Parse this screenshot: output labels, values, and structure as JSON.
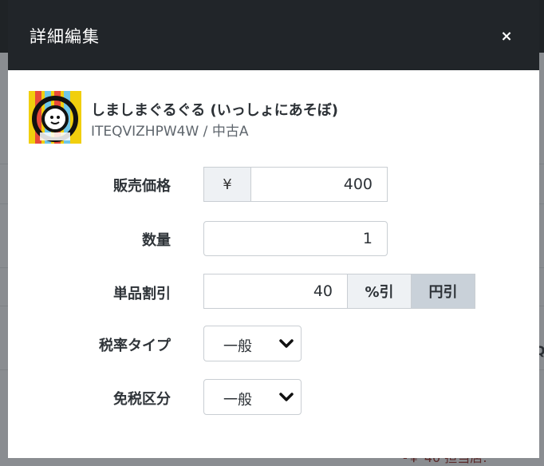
{
  "modal": {
    "title": "詳細編集",
    "close_symbol": "×"
  },
  "product": {
    "name": "しましまぐるぐる (いっしょにあそぼ)",
    "code_condition": "ITEQVIZHPW4W / 中古A"
  },
  "form": {
    "price": {
      "label": "販売価格",
      "currency_symbol": "¥",
      "value": "400"
    },
    "quantity": {
      "label": "数量",
      "value": "1"
    },
    "discount": {
      "label": "単品割引",
      "value": "40",
      "options": [
        "%引",
        "円引"
      ],
      "selected": "円引"
    },
    "tax_rate_type": {
      "label": "税率タイプ",
      "value": "一般"
    },
    "tax_exemption": {
      "label": "免税区分",
      "value": "一般"
    }
  },
  "background": {
    "partial_text": "-￥ 40   担当店:"
  },
  "colors": {
    "header_bg": "#212529",
    "addon_bg": "#eef1f4",
    "selected_segment_bg": "#c9d1d9",
    "overlay": "#8a8d91"
  },
  "icons": {
    "close": "close-icon",
    "select_arrow": "chevron-down-icon"
  }
}
